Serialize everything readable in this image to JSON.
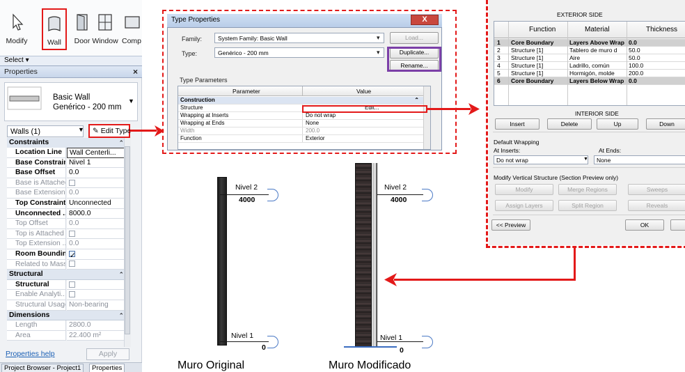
{
  "ribbon": {
    "buttons": [
      {
        "label": "Modify",
        "icon": "cursor-arrow-icon"
      },
      {
        "label": "Wall",
        "icon": "wall-icon"
      },
      {
        "label": "Door",
        "icon": "door-icon"
      },
      {
        "label": "Window",
        "icon": "window-icon"
      },
      {
        "label": "Comp",
        "icon": "component-icon"
      }
    ],
    "select_label": "Select ▾"
  },
  "properties": {
    "title": "Properties",
    "close": "×",
    "type_family": "Basic Wall",
    "type_name": "Genérico - 200 mm",
    "instance_filter": "Walls (1)",
    "edit_type": "Edit Type",
    "groups": {
      "constraints": "Constraints",
      "structural": "Structural",
      "dimensions": "Dimensions"
    },
    "rows": [
      {
        "name": "Location Line",
        "value": "Wall Centerli..."
      },
      {
        "name": "Base Constraint",
        "value": "Nivel 1"
      },
      {
        "name": "Base Offset",
        "value": "0.0"
      },
      {
        "name": "Base is Attached",
        "value": ""
      },
      {
        "name": "Base Extension...",
        "value": "0.0"
      },
      {
        "name": "Top Constraint",
        "value": "Unconnected"
      },
      {
        "name": "Unconnected ...",
        "value": "8000.0"
      },
      {
        "name": "Top Offset",
        "value": "0.0"
      },
      {
        "name": "Top is Attached",
        "value": ""
      },
      {
        "name": "Top Extension ...",
        "value": "0.0"
      },
      {
        "name": "Room Bounding",
        "value": ""
      },
      {
        "name": "Related to Mass",
        "value": ""
      },
      {
        "name": "Structural",
        "value": ""
      },
      {
        "name": "Enable Analyti...",
        "value": ""
      },
      {
        "name": "Structural Usage",
        "value": "Non-bearing"
      },
      {
        "name": "Length",
        "value": "2800.0"
      },
      {
        "name": "Area",
        "value": "22.400 m²"
      }
    ],
    "help_link": "Properties help",
    "apply": "Apply",
    "tabs": [
      "Project Browser - Project1",
      "Properties"
    ]
  },
  "type_properties": {
    "title": "Type Properties",
    "close": "X",
    "family_label": "Family:",
    "family_value": "System Family: Basic Wall",
    "type_label": "Type:",
    "type_value": "Genérico - 200 mm",
    "load": "Load...",
    "duplicate": "Duplicate...",
    "rename": "Rename...",
    "section_label": "Type Parameters",
    "col_parameter": "Parameter",
    "col_value": "Value",
    "group_construction": "Construction",
    "rows": [
      {
        "param": "Structure",
        "value": "Edit..."
      },
      {
        "param": "Wrapping at Inserts",
        "value": "Do not wrap"
      },
      {
        "param": "Wrapping at Ends",
        "value": "None"
      },
      {
        "param": "Width",
        "value": "200.0"
      },
      {
        "param": "Function",
        "value": "Exterior"
      }
    ]
  },
  "edit_assembly": {
    "exterior_side": "EXTERIOR SIDE",
    "interior_side": "INTERIOR SIDE",
    "col_function": "Function",
    "col_material": "Material",
    "col_thickness": "Thickness",
    "layers": [
      {
        "n": "1",
        "function": "Core Boundary",
        "material": "Layers Above Wrap",
        "thickness": "0.0"
      },
      {
        "n": "2",
        "function": "Structure [1]",
        "material": "Tablero de muro d",
        "thickness": "50.0"
      },
      {
        "n": "3",
        "function": "Structure [1]",
        "material": "Aire",
        "thickness": "50.0"
      },
      {
        "n": "4",
        "function": "Structure [1]",
        "material": "Ladrillo, común",
        "thickness": "100.0"
      },
      {
        "n": "5",
        "function": "Structure [1]",
        "material": "Hormigón, molde",
        "thickness": "200.0"
      },
      {
        "n": "6",
        "function": "Core Boundary",
        "material": "Layers Below Wrap",
        "thickness": "0.0"
      }
    ],
    "insert": "Insert",
    "delete": "Delete",
    "up": "Up",
    "down": "Down",
    "default_wrapping": "Default Wrapping",
    "at_inserts": "At Inserts:",
    "at_ends": "At Ends:",
    "at_inserts_value": "Do not wrap",
    "at_ends_value": "None",
    "modify_vertical": "Modify Vertical Structure (Section Preview only)",
    "modify": "Modify",
    "merge_regions": "Merge Regions",
    "sweeps": "Sweeps",
    "assign_layers": "Assign Layers",
    "split_region": "Split Region",
    "reveals": "Reveals",
    "preview": "<< Preview",
    "ok": "OK"
  },
  "levels": {
    "top_name": "Nivel 2",
    "top_value": "4000",
    "bottom_name": "Nivel 1",
    "bottom_value": "0"
  },
  "captions": {
    "original": "Muro Original",
    "modified": "Muro Modificado"
  },
  "colors": {
    "highlight_red": "#e31919",
    "highlight_purple": "#7b3fa7",
    "level_blue": "#4a79c5"
  }
}
